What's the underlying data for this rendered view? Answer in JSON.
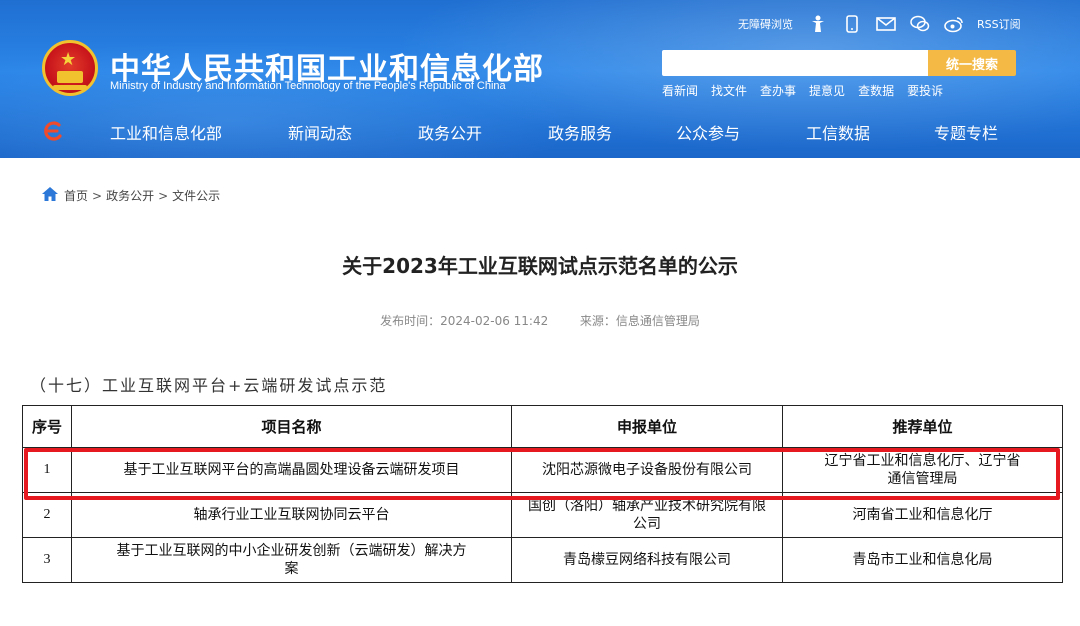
{
  "header": {
    "site_title": "中华人民共和国工业和信息化部",
    "site_subtitle": "Ministry of Industry and Information Technology of the People's Republic of China",
    "accessibility_label": "无障碍浏览",
    "rss_label": "RSS订阅",
    "search": {
      "placeholder": "",
      "button_label": "统一搜索"
    },
    "quick_links": [
      "看新闻",
      "找文件",
      "查办事",
      "提意见",
      "查数据",
      "要投诉"
    ],
    "nav": [
      "工业和信息化部",
      "新闻动态",
      "政务公开",
      "政务服务",
      "公众参与",
      "工信数据",
      "专题专栏"
    ]
  },
  "breadcrumb": [
    "首页",
    "政务公开",
    "文件公示"
  ],
  "breadcrumb_sep": ">",
  "article": {
    "title": "关于2023年工业互联网试点示范名单的公示",
    "publish_label": "发布时间：",
    "publish_time": "2024-02-06 11:42",
    "source_label": "来源：",
    "source": "信息通信管理局"
  },
  "section_heading": "（十七）工业互联网平台+云端研发试点示范",
  "table": {
    "headers": [
      "序号",
      "项目名称",
      "申报单位",
      "推荐单位"
    ],
    "rows": [
      {
        "no": "1",
        "name": "基于工业互联网平台的高端晶圆处理设备云端研发项目",
        "applicant": "沈阳芯源微电子设备股份有限公司",
        "recommender": "辽宁省工业和信息化厅、辽宁省通信管理局"
      },
      {
        "no": "2",
        "name": "轴承行业工业互联网协同云平台",
        "applicant": "国创（洛阳）轴承产业技术研究院有限公司",
        "recommender": "河南省工业和信息化厅"
      },
      {
        "no": "3",
        "name": "基于工业互联网的中小企业研发创新（云端研发）解决方案",
        "applicant": "青岛檬豆网络科技有限公司",
        "recommender": "青岛市工业和信息化局"
      }
    ]
  },
  "colors": {
    "header_blue": "#2b86e8",
    "search_button": "#f3b944",
    "highlight_red": "#e5191f"
  },
  "icons": [
    "accessibility-icon",
    "mobile-icon",
    "mail-icon",
    "wechat-icon",
    "weibo-icon",
    "home-icon"
  ]
}
